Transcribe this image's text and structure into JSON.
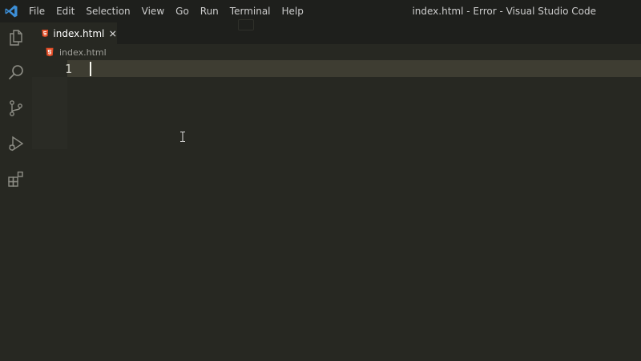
{
  "app": {
    "window_title": "index.html - Error - Visual Studio Code",
    "logo_icon": "vscode-logo-icon",
    "accent_color": "#3c8fd8"
  },
  "menu": {
    "items": [
      "File",
      "Edit",
      "Selection",
      "View",
      "Go",
      "Run",
      "Terminal",
      "Help"
    ]
  },
  "activity_bar": {
    "items": [
      {
        "icon": "explorer-files-icon"
      },
      {
        "icon": "search-icon"
      },
      {
        "icon": "source-control-icon"
      },
      {
        "icon": "run-debug-icon"
      },
      {
        "icon": "extensions-icon"
      }
    ]
  },
  "editor_tabs": [
    {
      "label": "index.html",
      "icon": "html5-file-icon",
      "active": true,
      "close_icon": "close-icon"
    }
  ],
  "breadcrumb": {
    "file": "index.html",
    "icon": "html5-file-icon"
  },
  "editor": {
    "line_numbers": [
      "1"
    ],
    "lines": [
      ""
    ],
    "cursor_line": 1,
    "html_icon_color": "#e44d26"
  }
}
